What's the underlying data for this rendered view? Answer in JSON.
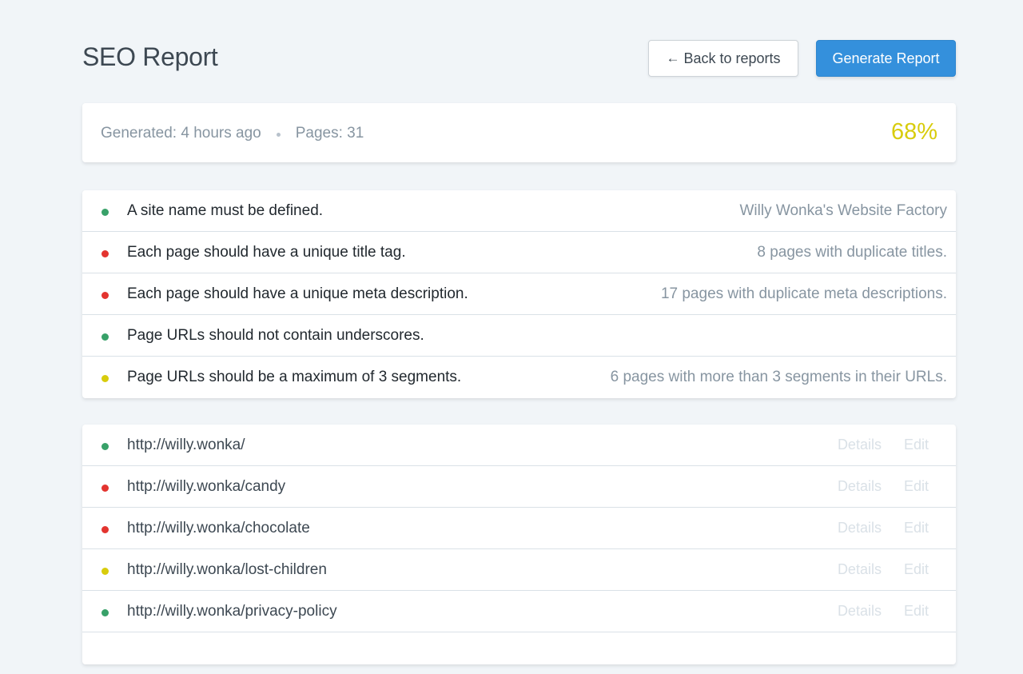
{
  "header": {
    "title": "SEO Report",
    "back_arrow": "←",
    "back_label": "Back to reports",
    "generate_label": "Generate Report"
  },
  "summary": {
    "generated": "Generated: 4 hours ago",
    "pages": "Pages: 31",
    "score": "68%",
    "score_color": "#d8cc0c"
  },
  "status_colors": {
    "green": "#38a169",
    "red": "#e3342f",
    "yellow": "#d8cc0c"
  },
  "checks": [
    {
      "status": "green",
      "label": "A site name must be defined.",
      "note": "Willy Wonka's Website Factory"
    },
    {
      "status": "red",
      "label": "Each page should have a unique title tag.",
      "note": "8 pages with duplicate titles."
    },
    {
      "status": "red",
      "label": "Each page should have a unique meta description.",
      "note": "17 pages with duplicate meta descriptions."
    },
    {
      "status": "green",
      "label": "Page URLs should not contain underscores.",
      "note": ""
    },
    {
      "status": "yellow",
      "label": "Page URLs should be a maximum of 3 segments.",
      "note": "6 pages with more than 3 segments in their URLs."
    }
  ],
  "pages": {
    "details_label": "Details",
    "edit_label": "Edit",
    "items": [
      {
        "status": "green",
        "url": "http://willy.wonka/"
      },
      {
        "status": "red",
        "url": "http://willy.wonka/candy"
      },
      {
        "status": "red",
        "url": "http://willy.wonka/chocolate"
      },
      {
        "status": "yellow",
        "url": "http://willy.wonka/lost-children"
      },
      {
        "status": "green",
        "url": "http://willy.wonka/privacy-policy"
      }
    ]
  }
}
